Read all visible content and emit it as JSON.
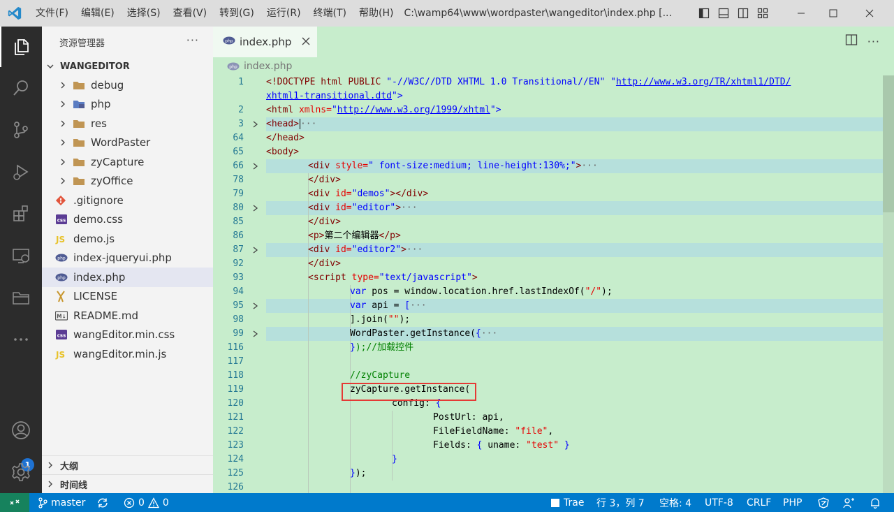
{
  "titlebar": {
    "menu": [
      "文件(F)",
      "编辑(E)",
      "选择(S)",
      "查看(V)",
      "转到(G)",
      "运行(R)",
      "终端(T)",
      "帮助(H)"
    ],
    "title": "C:\\wamp64\\www\\wordpaster\\wangeditor\\index.php [..."
  },
  "sidebar": {
    "header": "资源管理器",
    "root": "WANGEDITOR",
    "items": [
      {
        "label": "debug",
        "type": "folder"
      },
      {
        "label": "php",
        "type": "folder-php"
      },
      {
        "label": "res",
        "type": "folder"
      },
      {
        "label": "WordPaster",
        "type": "folder"
      },
      {
        "label": "zyCapture",
        "type": "folder"
      },
      {
        "label": "zyOffice",
        "type": "folder"
      },
      {
        "label": ".gitignore",
        "type": "git"
      },
      {
        "label": "demo.css",
        "type": "css"
      },
      {
        "label": "demo.js",
        "type": "js"
      },
      {
        "label": "index-jqueryui.php",
        "type": "php"
      },
      {
        "label": "index.php",
        "type": "php"
      },
      {
        "label": "LICENSE",
        "type": "license"
      },
      {
        "label": "README.md",
        "type": "md"
      },
      {
        "label": "wangEditor.min.css",
        "type": "css"
      },
      {
        "label": "wangEditor.min.js",
        "type": "js"
      }
    ],
    "outline": "大纲",
    "timeline": "时间线"
  },
  "editor": {
    "tab_label": "index.php",
    "breadcrumb": "index.php",
    "line_numbers": [
      "1",
      "",
      "2",
      "3",
      "64",
      "65",
      "66",
      "78",
      "79",
      "80",
      "85",
      "86",
      "87",
      "92",
      "93",
      "94",
      "95",
      "98",
      "99",
      "116",
      "117",
      "118",
      "119",
      "120",
      "121",
      "122",
      "123",
      "124",
      "125",
      "126"
    ],
    "code": {
      "l1_doctype": "<!DOCTYPE html PUBLIC",
      "l1_fpi": "\"-//W3C//DTD XHTML 1.0 Transitional//EN\"",
      "l1_q": "\"",
      "l1_url": "http://www.w3.org/TR/xhtml1/DTD/",
      "l1b_url": "xhtml1-transitional.dtd",
      "l1b_end": "\">",
      "l2_tag": "<html",
      "l2_attr": "xmlns=",
      "l2_q": "\"",
      "l2_url": "http://www.w3.org/1999/xhtml",
      "l2_end": "\">",
      "l3_tag": "<head>",
      "l64_tag": "</head>",
      "l65_tag": "<body>",
      "l66_tag": "<div",
      "l66_attr": "style=",
      "l66_str": "\" font-size:medium; line-height:130%;\"",
      "l66_end": ">",
      "l78_tag": "</div>",
      "l79_tag": "<div",
      "l79_attr": "id=",
      "l79_str": "\"demos\"",
      "l79_end": "></div>",
      "l80_tag": "<div",
      "l80_attr": "id=",
      "l80_str": "\"editor\"",
      "l80_end": ">",
      "l85_tag": "</div>",
      "l86_open": "<p>",
      "l86_txt": "第二个编辑器",
      "l86_close": "</p>",
      "l87_tag": "<div",
      "l87_attr": "id=",
      "l87_str": "\"editor2\"",
      "l87_end": ">",
      "l92_tag": "</div>",
      "l93_tag": "<script",
      "l93_attr": "type=",
      "l93_str": "\"text/javascript\"",
      "l93_end": ">",
      "l94_kw": "var",
      "l94_txt": " pos = window.location.href.lastIndexOf(",
      "l94_str": "\"/\"",
      "l94_end": ");",
      "l95_kw": "var",
      "l95_txt": " api = ",
      "l95_br": "[",
      "l98_txt": "].join(",
      "l98_str": "\"\"",
      "l98_end": ");",
      "l99_txt": "WordPaster.getInstance(",
      "l99_br": "{",
      "l116_br": "}",
      "l116_txt": ");//加载控件",
      "l118_cm": "//zyCapture",
      "l119_txt": "zyCapture.getInstance(",
      "l120_txt": "config: ",
      "l120_br": "{",
      "l121_txt": "PostUrl: api,",
      "l122_txt": "FileFieldName: ",
      "l122_str": "\"file\"",
      "l122_end": ",",
      "l123_txt": "Fields: ",
      "l123_br1": "{",
      "l123_k": " uname: ",
      "l123_str": "\"test\"",
      "l123_br2": " }",
      "l124_br": "}",
      "l125_br": "}",
      "l125_end": ");",
      "fold": "···"
    }
  },
  "statusbar": {
    "branch": "master",
    "errors": "0",
    "warnings": "0",
    "trae": "Trae",
    "position": "行 3，列 7",
    "spaces": "空格: 4",
    "encoding": "UTF-8",
    "eol": "CRLF",
    "language": "PHP",
    "accounts_badge": "1"
  },
  "colors": {
    "editor_bg": "#c7edcc",
    "statusbar_bg": "#007acc",
    "activitybar_bg": "#2c2c2c",
    "highlight": "#e53935"
  }
}
